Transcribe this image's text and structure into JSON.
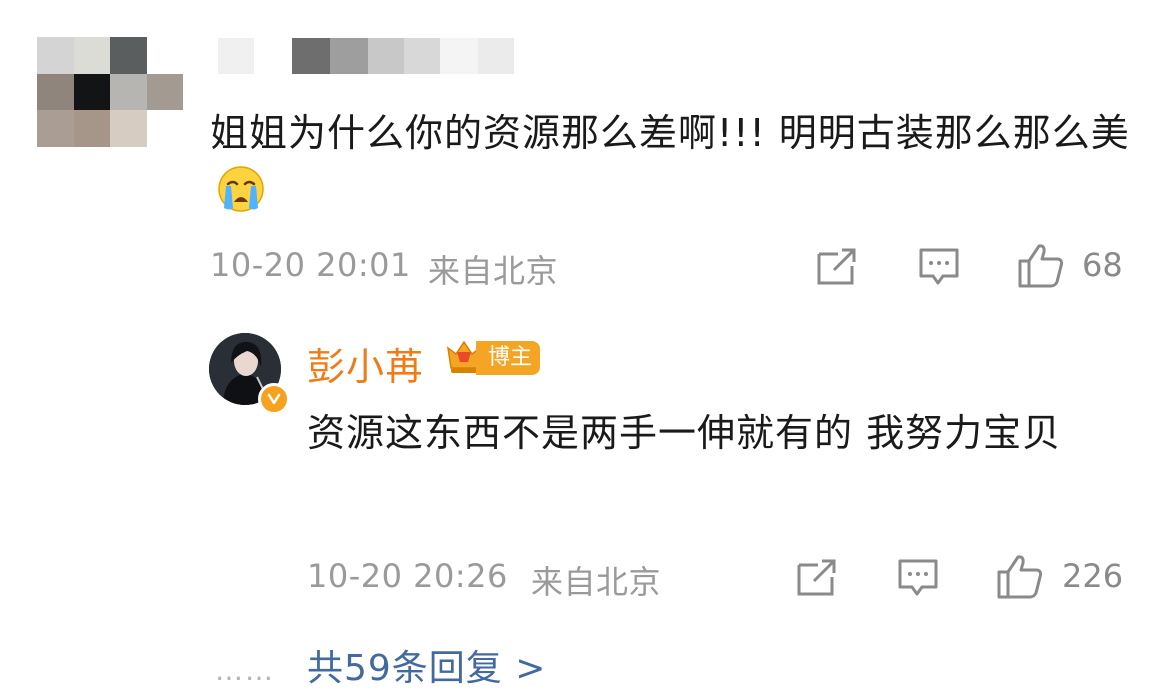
{
  "comment": {
    "text": "姐姐为什么你的资源那么差啊!!! 明明古装那么那么美",
    "emoji": "loudly-crying-face",
    "timestamp": "10-20 20:01",
    "location": "来自北京",
    "likes": "68"
  },
  "reply": {
    "username": "彭小苒",
    "badge_label": "博主",
    "text": "资源这东西不是两手一伸就有的 我努力宝贝",
    "timestamp": "10-20 20:26",
    "location": "来自北京",
    "likes": "226"
  },
  "thread": {
    "dots": "……",
    "more_replies_label": "共59条回复 >"
  },
  "colors": {
    "username_orange": "#f07c18",
    "link_blue": "#436a9f",
    "meta_gray": "#9a9a9a",
    "badge_gold": "#f5a524"
  }
}
